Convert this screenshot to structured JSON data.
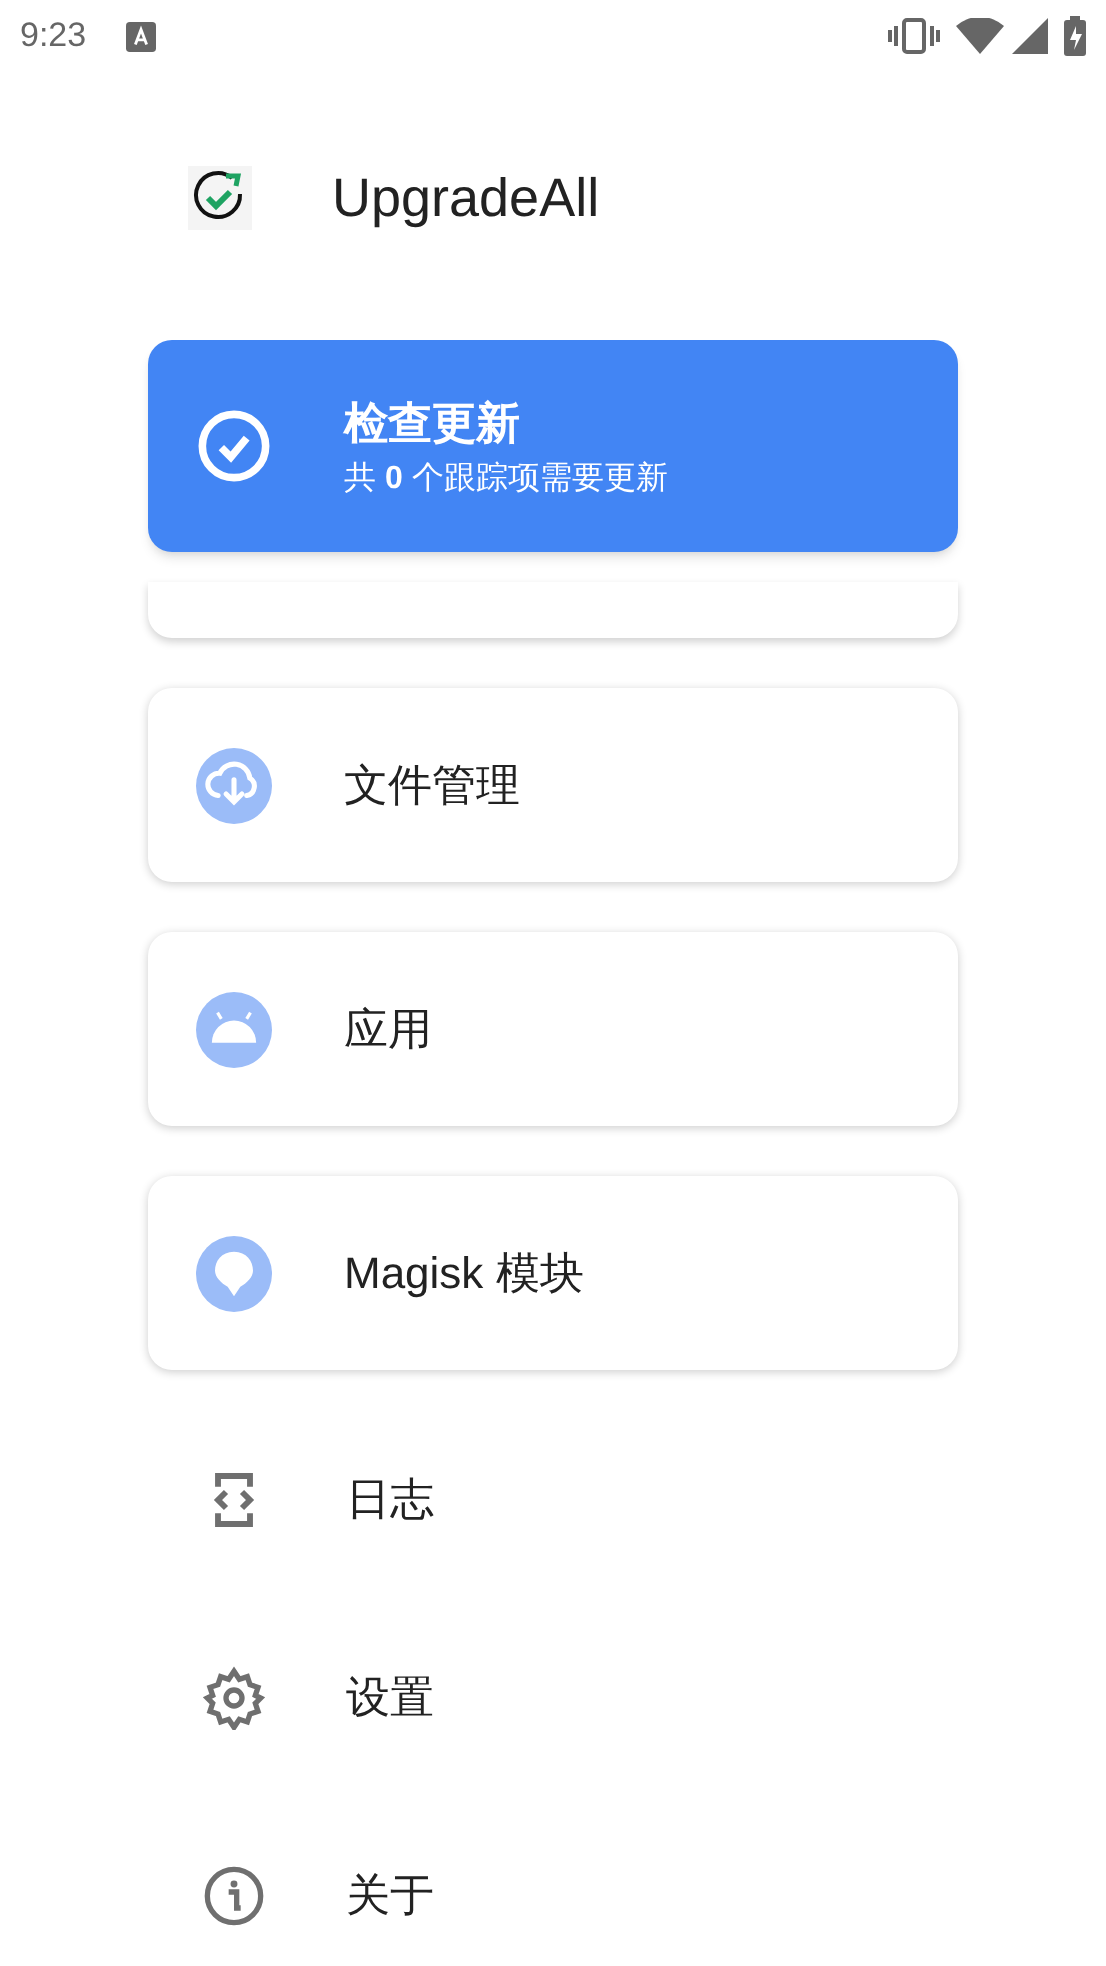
{
  "status_bar": {
    "time": "9:23"
  },
  "app": {
    "title": "UpgradeAll"
  },
  "update_card": {
    "title": "检查更新",
    "subtitle": "共 **0** 个跟踪项需要更新"
  },
  "menu": [
    {
      "kind": "card",
      "label": "文件管理"
    },
    {
      "kind": "card",
      "label": "应用"
    },
    {
      "kind": "card",
      "label": "Magisk 模块"
    },
    {
      "kind": "plain",
      "label": "日志"
    },
    {
      "kind": "plain",
      "label": "设置"
    },
    {
      "kind": "plain",
      "label": "关于"
    }
  ]
}
